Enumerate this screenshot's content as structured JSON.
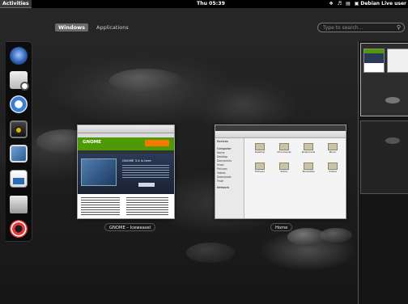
{
  "topbar": {
    "activities_label": "Activities",
    "clock": "Thu 05:39",
    "user_name": "Debian Live user",
    "indicators": [
      "network-icon",
      "volume-icon",
      "battery-icon",
      "user-icon"
    ]
  },
  "view_tabs": [
    {
      "label": "Windows",
      "active": true
    },
    {
      "label": "Applications",
      "active": false
    }
  ],
  "search": {
    "placeholder": "Type to search..."
  },
  "dash": {
    "items": [
      {
        "name": "web-browser-icon"
      },
      {
        "name": "evolution-mail-icon"
      },
      {
        "name": "empathy-chat-icon"
      },
      {
        "name": "rhythmbox-music-icon"
      },
      {
        "name": "shotwell-photos-icon"
      },
      {
        "name": "libreoffice-writer-icon"
      },
      {
        "name": "files-icon"
      },
      {
        "name": "help-icon"
      }
    ]
  },
  "windows": [
    {
      "label": "GNOME – Iceweasel"
    },
    {
      "label": "Home"
    }
  ],
  "browser_thumb": {
    "logo": "GNOME",
    "headline": "GNOME 3.4 is here",
    "news_heading": "Latest News",
    "accent": "#4e9a06"
  },
  "files_thumb": {
    "sidebar_heading": "Devices",
    "places_heading": "Computer",
    "network_heading": "Network",
    "places": [
      "Home",
      "Desktop",
      "Documents",
      "Music",
      "Pictures",
      "Videos",
      "Downloads",
      "Trash"
    ],
    "folders": [
      "Desktop",
      "Documents",
      "Downloads",
      "Music",
      "Pictures",
      "Public",
      "Templates",
      "Videos"
    ]
  },
  "colors": {
    "top_bar": "#000000",
    "panel": "#0a0a0a",
    "folder": "#c9c4a8"
  }
}
